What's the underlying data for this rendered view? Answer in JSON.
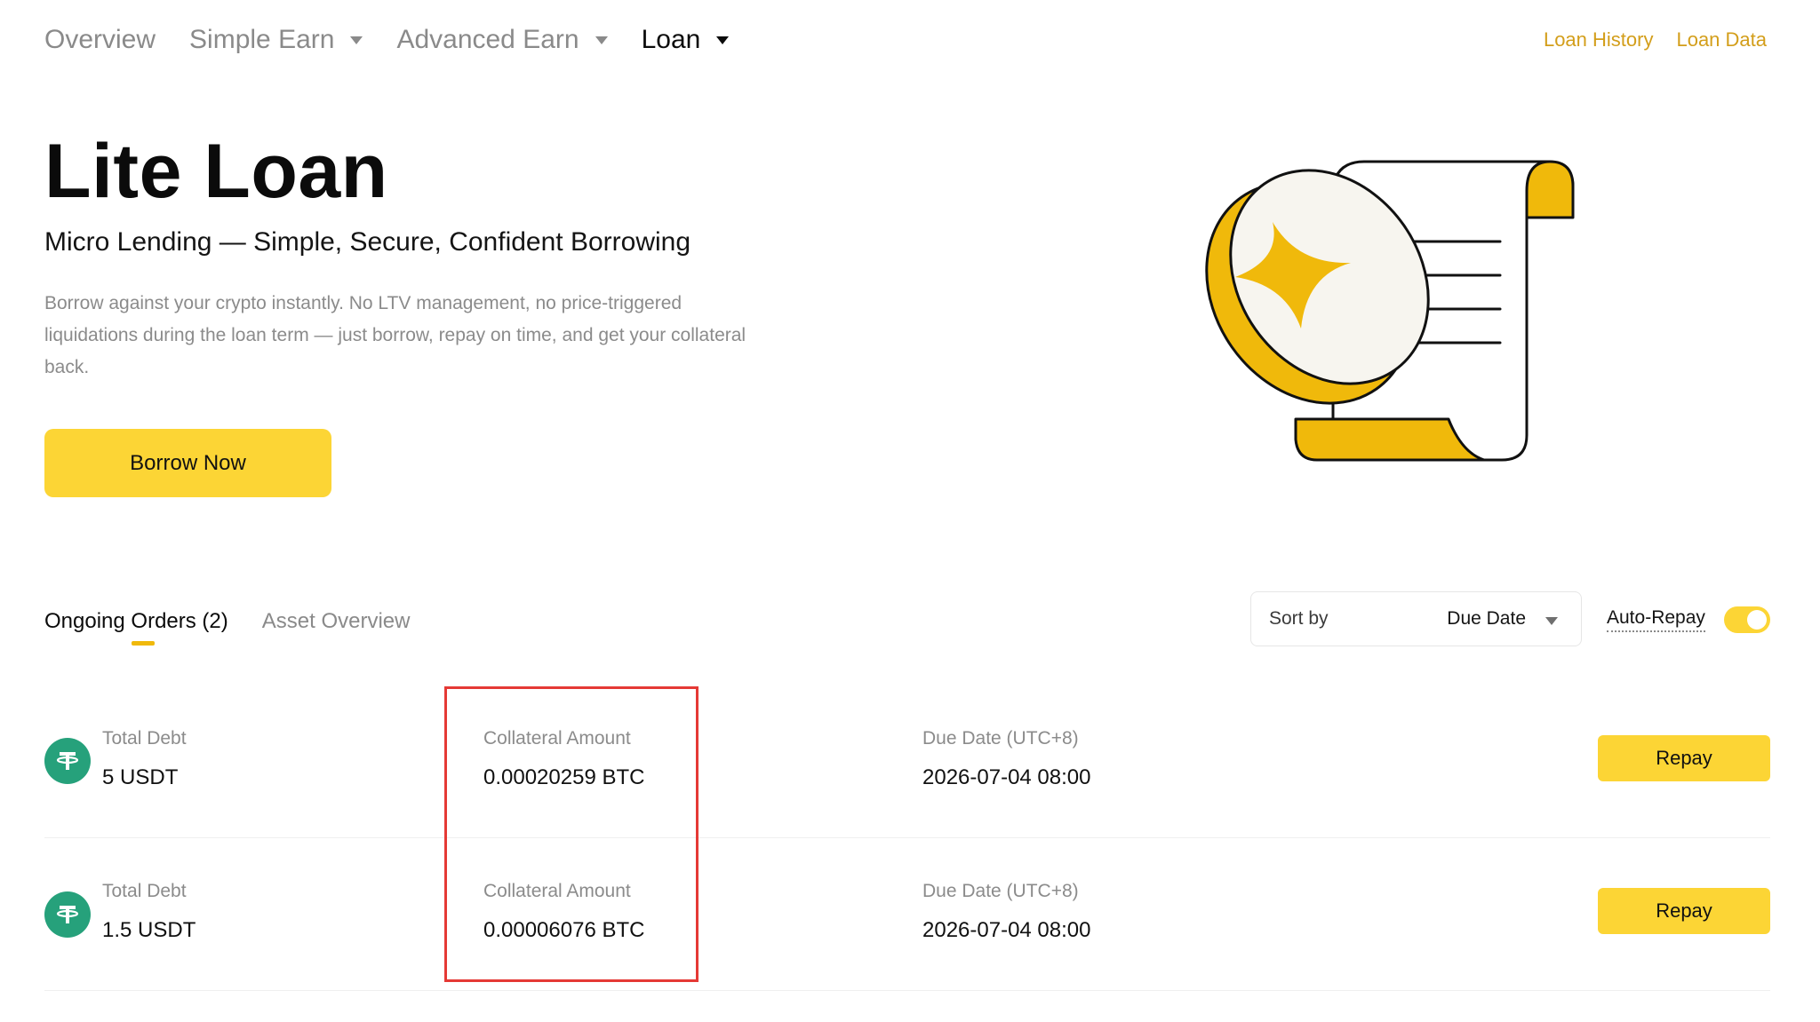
{
  "nav": {
    "items": [
      {
        "label": "Overview",
        "has_dropdown": false,
        "active": false
      },
      {
        "label": "Simple Earn",
        "has_dropdown": true,
        "active": false
      },
      {
        "label": "Advanced Earn",
        "has_dropdown": true,
        "active": false
      },
      {
        "label": "Loan",
        "has_dropdown": true,
        "active": true
      }
    ],
    "links": [
      "Loan History",
      "Loan Data"
    ]
  },
  "hero": {
    "title": "Lite Loan",
    "subtitle": "Micro Lending — Simple, Secure, Confident Borrowing",
    "description": "Borrow against your crypto instantly. No LTV management, no price-triggered liquidations during the loan term — just borrow, repay on time, and get your collateral back.",
    "cta_label": "Borrow Now"
  },
  "tabs": [
    {
      "label": "Ongoing Orders (2)",
      "active": true
    },
    {
      "label": "Asset Overview",
      "active": false
    }
  ],
  "sort": {
    "label": "Sort by",
    "value": "Due Date"
  },
  "auto_repay": {
    "label": "Auto-Repay",
    "enabled": true
  },
  "orders": [
    {
      "coin": "USDT",
      "debt_label": "Total Debt",
      "debt_value": "5 USDT",
      "collateral_label": "Collateral Amount",
      "collateral_value": "0.00020259 BTC",
      "due_label": "Due Date (UTC+8)",
      "due_value": "2026-07-04 08:00",
      "action_label": "Repay"
    },
    {
      "coin": "USDT",
      "debt_label": "Total Debt",
      "debt_value": "1.5 USDT",
      "collateral_label": "Collateral Amount",
      "collateral_value": "0.00006076 BTC",
      "due_label": "Due Date (UTC+8)",
      "due_value": "2026-07-04 08:00",
      "action_label": "Repay"
    }
  ],
  "colors": {
    "accent_yellow": "#fcd535",
    "link_gold": "#d39e1a",
    "tether_green": "#26a17b",
    "highlight_red": "#e53935"
  },
  "icons": {
    "coin": "tether-icon",
    "dropdown": "caret-down-icon",
    "illustration": "coin-and-scroll-illustration"
  }
}
